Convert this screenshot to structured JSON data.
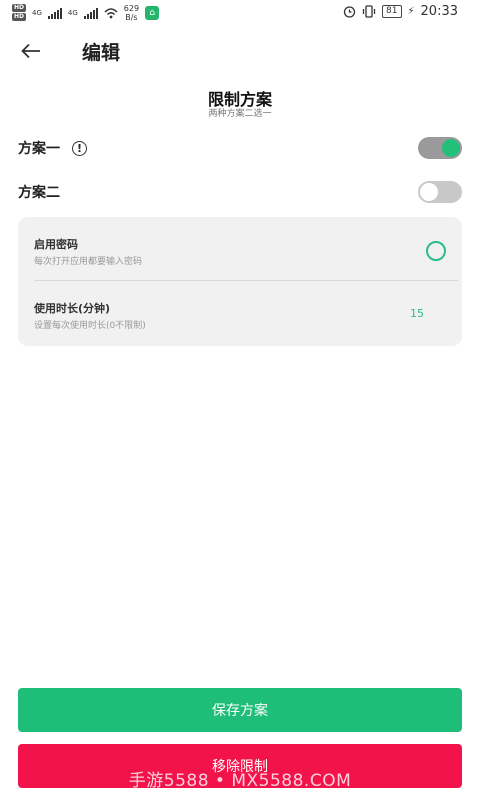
{
  "status_bar": {
    "hd1": "HD",
    "hd2": "HD",
    "sig1": "4G",
    "sig2": "4G",
    "net_speed_value": "629",
    "net_speed_unit": "B/s",
    "battery": "81",
    "time": "20:33"
  },
  "header": {
    "title": "编辑"
  },
  "section": {
    "title": "限制方案",
    "subtitle": "两种方案二选一"
  },
  "plans": [
    {
      "label": "方案一",
      "enabled": true
    },
    {
      "label": "方案二",
      "enabled": false
    }
  ],
  "settings": {
    "password": {
      "title": "启用密码",
      "desc": "每次打开应用都要输入密码"
    },
    "duration": {
      "title": "使用时长(分钟)",
      "desc": "设置每次使用时长(0不限制)",
      "value": "15"
    }
  },
  "buttons": {
    "save": "保存方案",
    "remove": "移除限制"
  },
  "watermark": "手游5588 • MX5588.COM",
  "colors": {
    "accent": "#1fbe78",
    "danger": "#f2134a"
  }
}
